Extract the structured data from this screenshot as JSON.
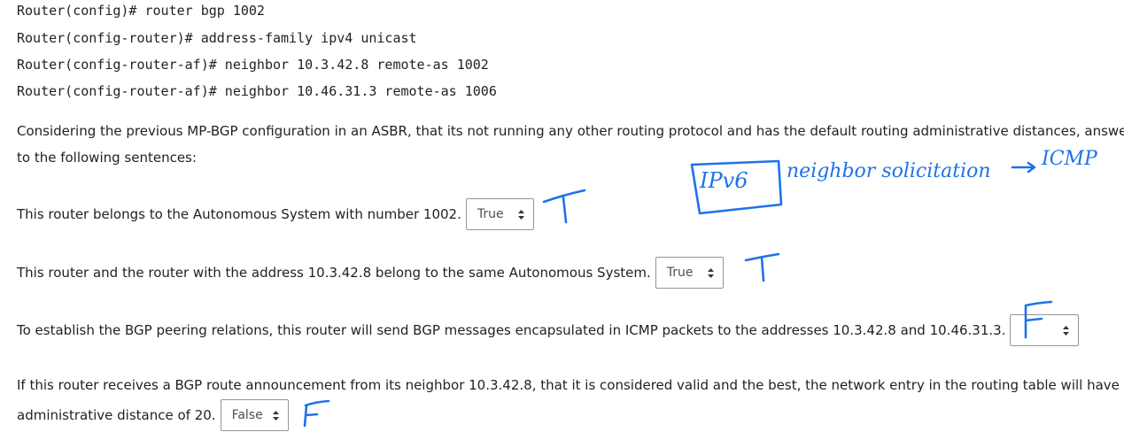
{
  "code_lines": [
    "Router(config)# router bgp 1002",
    "Router(config-router)# address-family ipv4 unicast",
    "Router(config-router-af)# neighbor 10.3.42.8 remote-as 1002",
    "Router(config-router-af)# neighbor 10.46.31.3 remote-as 1006"
  ],
  "intro": {
    "line1": "Considering the previous MP-BGP configuration in an ASBR, that its not running any other routing protocol and has the default routing administrative distances, answe",
    "line2": "to the following sentences:"
  },
  "questions": [
    {
      "text": "This router belongs to the Autonomous System with number 1002.",
      "selected": "True"
    },
    {
      "text": "This router and the router with the address 10.3.42.8 belong to the same Autonomous System.",
      "selected": "True"
    },
    {
      "text": "To establish the BGP peering relations, this router will send BGP messages encapsulated in ICMP packets to the addresses 10.3.42.8 and 10.46.31.3.",
      "selected": ""
    },
    {
      "text_line1": "If this router receives a BGP route announcement from its neighbor 10.3.42.8, that it is considered valid and the best, the network entry in the routing table will have",
      "text_line2": "administrative distance of 20.",
      "selected": "False"
    }
  ],
  "annotations": {
    "boxed_note": "IPv6",
    "note": "neighbor solicitation",
    "arrow_target": "ICMP",
    "answer_marks": [
      "T",
      "T",
      "F",
      "F"
    ],
    "ink_color": "#1e73e8"
  },
  "icons": {
    "select_arrow": "up-down-caret-icon"
  }
}
